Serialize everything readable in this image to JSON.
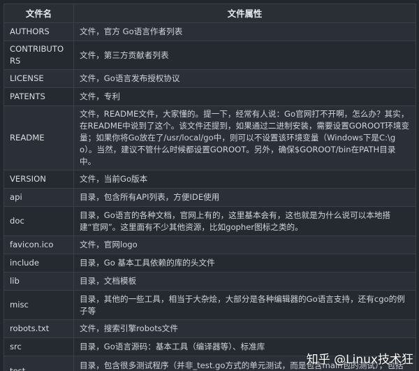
{
  "table": {
    "headers": [
      "文件名",
      "文件属性"
    ],
    "rows": [
      {
        "name": "AUTHORS",
        "attr": "文件，官方 Go语言作者列表"
      },
      {
        "name": "CONTRIBUTORS",
        "attr": "文件，第三方贡献者列表"
      },
      {
        "name": "LICENSE",
        "attr": "文件，Go语言发布授权协议"
      },
      {
        "name": "PATENTS",
        "attr": "文件，专利"
      },
      {
        "name": "README",
        "attr": "文件，README文件，大家懂的。提一下，经常有人说：Go官网打不开啊，怎么办？其实，在README中说到了这个。该文件还提到，如果通过二进制安装，需要设置GOROOT环境变量；如果你将Go放在了/usr/local/go中，则可以不设置该环境变量（Windows下是C:\\go）。当然，建议不管什么时候都设置GOROOT。另外，确保$GOROOT/bin在PATH目录中。"
      },
      {
        "name": "VERSION",
        "attr": "文件，当前Go版本"
      },
      {
        "name": "api",
        "attr": "目录，包含所有API列表，方便IDE使用"
      },
      {
        "name": "doc",
        "attr": "目录，Go语言的各种文档，官网上有的，这里基本会有，这也就是为什么说可以本地搭建“官网”。这里面有不少其他资源，比如gopher图标之类的。"
      },
      {
        "name": "favicon.ico",
        "attr": "文件，官网logo"
      },
      {
        "name": "include",
        "attr": "目录，Go 基本工具依赖的库的头文件"
      },
      {
        "name": "lib",
        "attr": "目录，文档模板"
      },
      {
        "name": "misc",
        "attr": "目录，其他的一些工具，相当于大杂烩，大部分是各种编辑器的Go语言支持，还有cgo的例子等"
      },
      {
        "name": "robots.txt",
        "attr": "文件，搜索引擎robots文件"
      },
      {
        "name": "src",
        "attr": "目录，Go语言源码：基本工具（编译器等）、标准库"
      },
      {
        "name": "test",
        "attr": "目录，包含很多测试程序（并非_test.go方式的单元测试，而是包含main包的测试），包括一些fixbug测试。可以通过这个学到一些特性的使用。"
      }
    ]
  },
  "watermark": "知乎 @Linux技术狂"
}
